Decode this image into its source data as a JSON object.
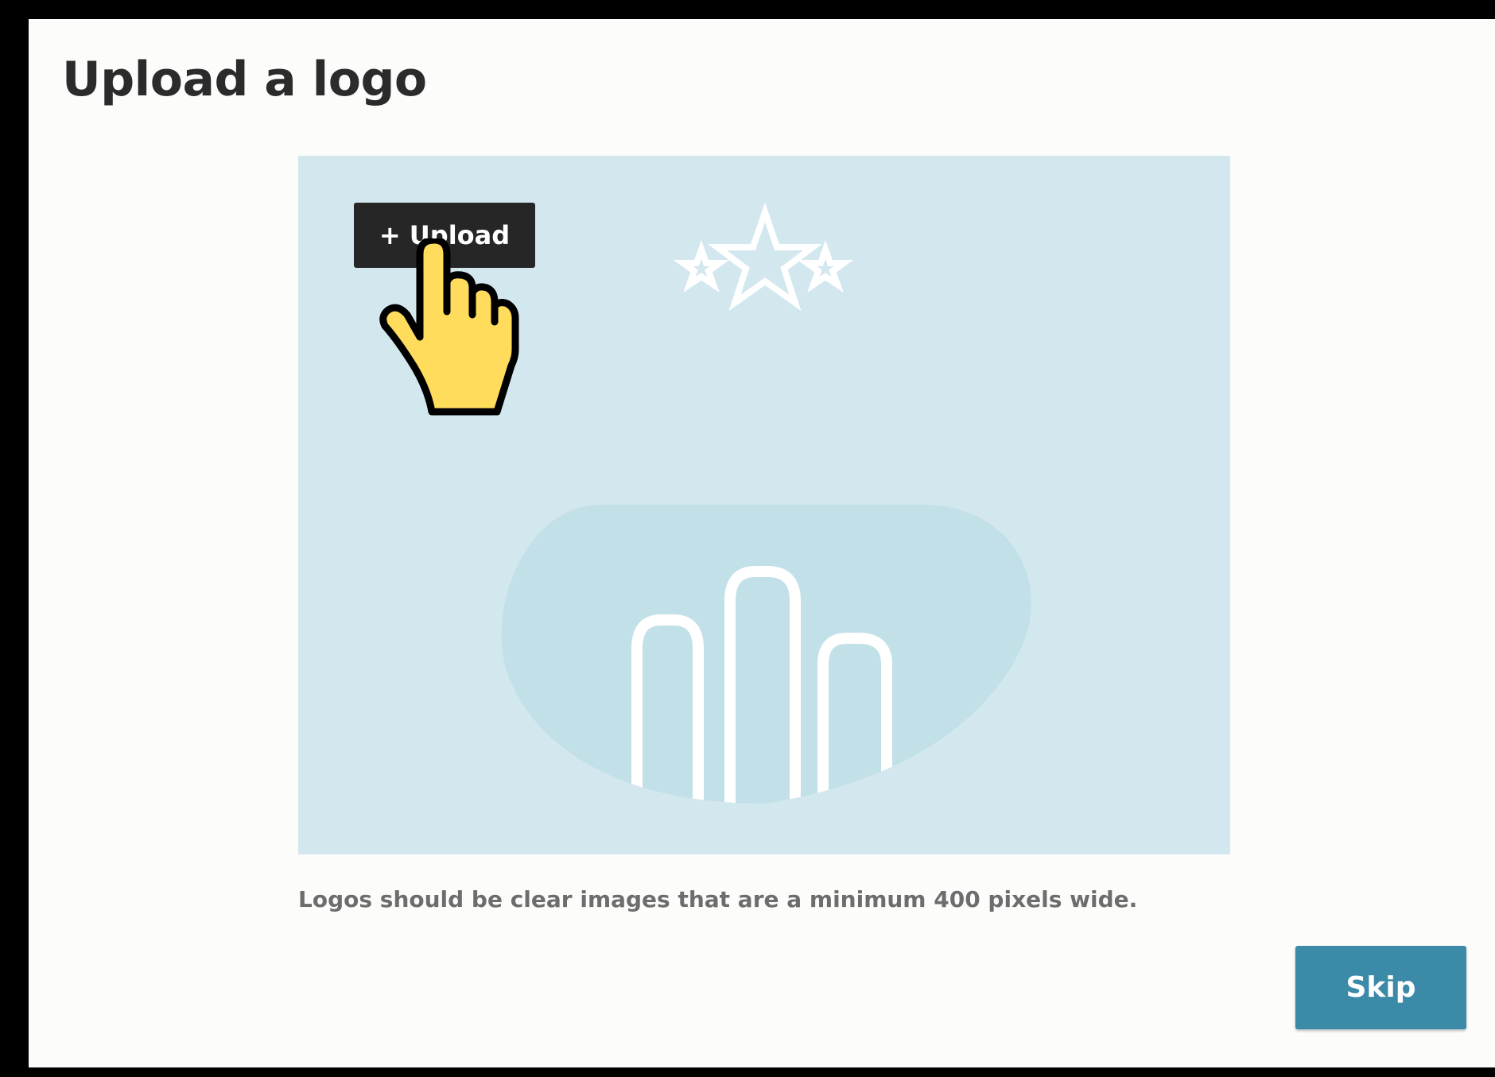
{
  "page": {
    "title": "Upload a logo"
  },
  "upload_area": {
    "upload_button_label": "+ Upload",
    "illustration_icon": "logo-placeholder-illustration",
    "stars_icon": "stars-icon",
    "bars_icon": "bar-columns-icon"
  },
  "hint": {
    "text": "Logos should be clear images that are a minimum 400 pixels wide."
  },
  "actions": {
    "skip_label": "Skip"
  },
  "cursor": {
    "icon": "pointing-hand-cursor"
  },
  "colors": {
    "upload_area_bg": "#d3e7ef",
    "blob_bg": "#c2e0e8",
    "upload_button_bg": "#262626",
    "skip_button_bg": "#3a8aa8",
    "hand_fill": "#ffdc5b"
  }
}
